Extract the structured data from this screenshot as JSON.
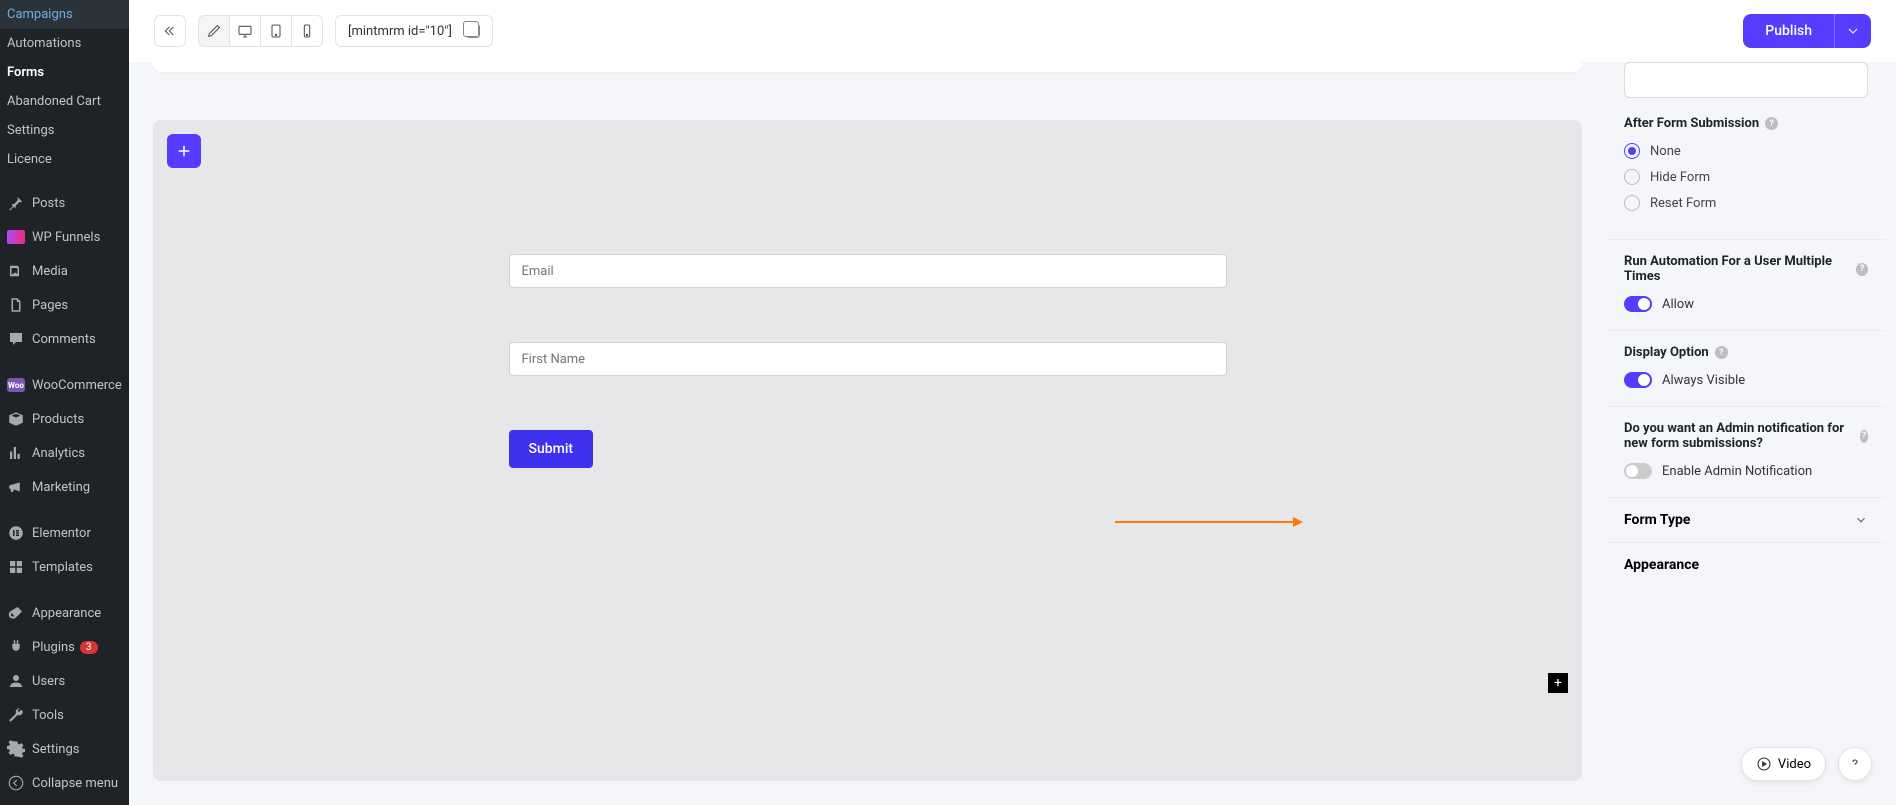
{
  "sidebar": {
    "sub_items": [
      "Campaigns",
      "Automations",
      "Forms",
      "Abandoned Cart",
      "Settings",
      "Licence"
    ],
    "active_sub": "Forms",
    "items": [
      {
        "label": "Posts",
        "icon": "pin"
      },
      {
        "label": "WP Funnels",
        "icon": "wpf"
      },
      {
        "label": "Media",
        "icon": "media"
      },
      {
        "label": "Pages",
        "icon": "page"
      },
      {
        "label": "Comments",
        "icon": "comment"
      },
      {
        "label": "WooCommerce",
        "icon": "woo"
      },
      {
        "label": "Products",
        "icon": "box"
      },
      {
        "label": "Analytics",
        "icon": "chart"
      },
      {
        "label": "Marketing",
        "icon": "horn"
      },
      {
        "label": "Elementor",
        "icon": "elementor"
      },
      {
        "label": "Templates",
        "icon": "templates"
      },
      {
        "label": "Appearance",
        "icon": "brush"
      },
      {
        "label": "Plugins",
        "icon": "plug",
        "badge": "3"
      },
      {
        "label": "Users",
        "icon": "user"
      },
      {
        "label": "Tools",
        "icon": "wrench"
      },
      {
        "label": "Settings",
        "icon": "gear"
      },
      {
        "label": "Collapse menu",
        "icon": "collapse"
      }
    ]
  },
  "topbar": {
    "shortcode": "[mintmrm id=\"10\"]",
    "publish_label": "Publish"
  },
  "form": {
    "email_placeholder": "Email",
    "firstname_placeholder": "First Name",
    "submit_label": "Submit"
  },
  "settings": {
    "after_submission": {
      "label": "After Form Submission",
      "options": [
        "None",
        "Hide Form",
        "Reset Form"
      ],
      "selected": "None"
    },
    "run_automation": {
      "label": "Run Automation For a User Multiple Times",
      "toggle_label": "Allow",
      "on": true
    },
    "display_option": {
      "label": "Display Option",
      "toggle_label": "Always Visible",
      "on": true
    },
    "admin_notif": {
      "label": "Do you want an Admin notification for new form submissions?",
      "toggle_label": "Enable Admin Notification",
      "on": false
    },
    "acc_form_type": "Form Type",
    "acc_appearance": "Appearance"
  },
  "float": {
    "video_label": "Video"
  }
}
